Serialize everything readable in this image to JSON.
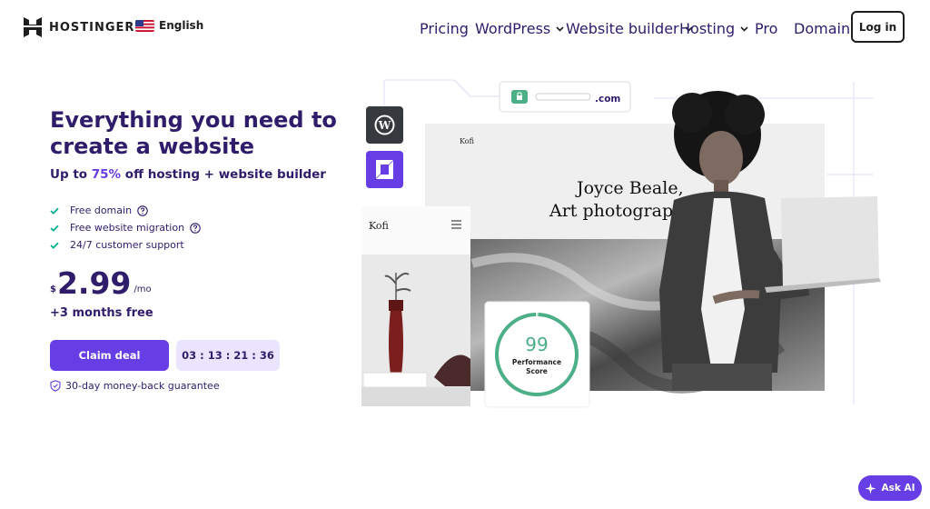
{
  "header": {
    "brand": "HOSTINGER",
    "language": "English",
    "nav": [
      {
        "label": "Pricing",
        "dropdown": false
      },
      {
        "label": "WordPress",
        "dropdown": true
      },
      {
        "label": "Website builder",
        "dropdown": true
      },
      {
        "label": "Hosting",
        "dropdown": true
      },
      {
        "label": "Pro",
        "dropdown": false
      },
      {
        "label": "Domains",
        "dropdown": false
      }
    ],
    "login_label": "Log in"
  },
  "hero": {
    "title": "Everything you need to create a website",
    "subtitle_prefix": "Up to ",
    "subtitle_accent": "75%",
    "subtitle_suffix": " off hosting + website builder",
    "features": [
      {
        "label": "Free domain",
        "help": true
      },
      {
        "label": "Free website migration",
        "help": true
      },
      {
        "label": "24/7 customer support",
        "help": false
      }
    ],
    "price": {
      "currency": "$",
      "amount": "2.99",
      "period": "/mo"
    },
    "bonus": "+3 months free",
    "cta_label": "Claim deal",
    "timer": "03 : 13 : 21 : 36",
    "guarantee": "30-day money-back guarantee"
  },
  "illustration": {
    "url_suffix": ".com",
    "site_name": "Kofi",
    "headline_line1": "Joyce Beale,",
    "headline_line2": "Art photograph",
    "mobile_site_name": "Kofi",
    "score": "99",
    "score_label_line1": "Performance",
    "score_label_line2": "Score"
  },
  "assistant": {
    "label": "Ask AI"
  },
  "colors": {
    "brand": "#673de6",
    "text": "#2f1c6a",
    "success": "#00b090",
    "score_ring": "#4caf88"
  }
}
